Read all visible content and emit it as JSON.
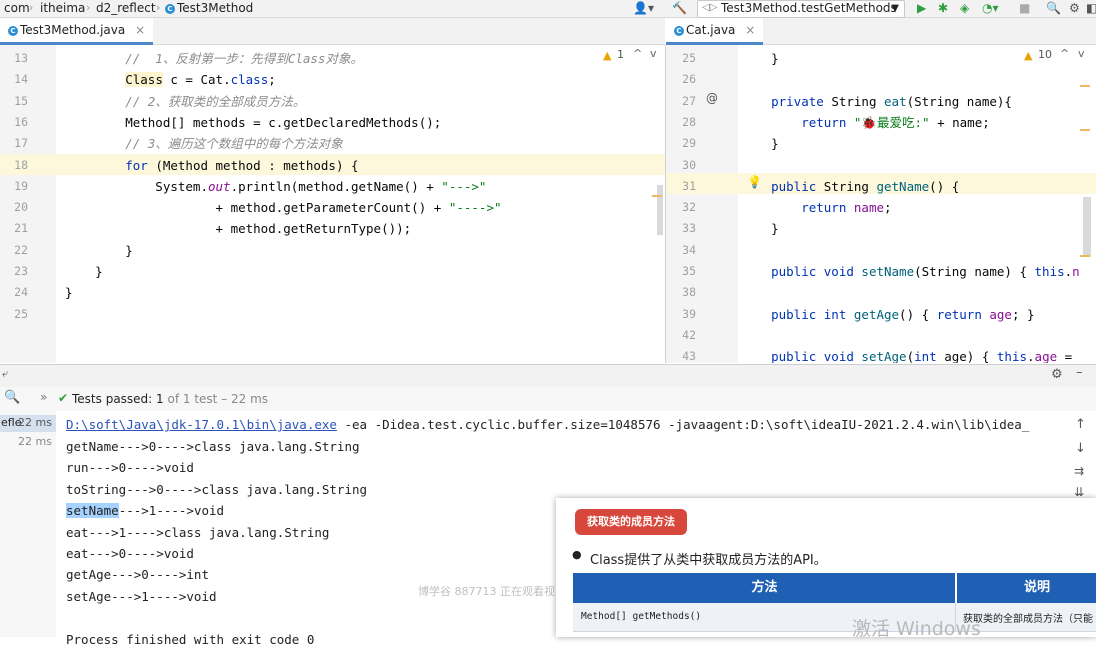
{
  "breadcrumb": [
    "com",
    "itheima",
    "d2_reflect",
    "Test3Method"
  ],
  "run_config": "Test3Method.testGetMethods",
  "left_editor": {
    "tab": "Test3Method.java",
    "warnings": "1",
    "lines": [
      {
        "n": "13",
        "code": [
          [
            "cm",
            "        //  1、反射第一步：先得到Class对象。"
          ]
        ]
      },
      {
        "n": "14",
        "code": [
          [
            "",
            "        "
          ],
          [
            "hl",
            "Class"
          ],
          [
            "",
            " c = Cat."
          ],
          [
            "kw",
            "class"
          ],
          [
            "",
            ";"
          ]
        ]
      },
      {
        "n": "15",
        "code": [
          [
            "cm",
            "        // 2、获取类的全部成员方法。"
          ]
        ]
      },
      {
        "n": "16",
        "code": [
          [
            "",
            "        Method[] methods = c.getDeclaredMethods();"
          ]
        ]
      },
      {
        "n": "17",
        "code": [
          [
            "cm",
            "        // 3、遍历这个数组中的每个方法对象"
          ]
        ]
      },
      {
        "n": "18",
        "code": [
          [
            "",
            "        "
          ],
          [
            "kw",
            "for"
          ],
          [
            "",
            " (Method method : methods) {"
          ]
        ]
      },
      {
        "n": "19",
        "code": [
          [
            "",
            "            System."
          ],
          [
            "fdi",
            "out"
          ],
          [
            "",
            ".println(method.getName() + "
          ],
          [
            "st",
            "\"--->\""
          ]
        ]
      },
      {
        "n": "20",
        "code": [
          [
            "",
            "                    + method.getParameterCount() + "
          ],
          [
            "st",
            "\"---->\""
          ]
        ]
      },
      {
        "n": "21",
        "code": [
          [
            "",
            "                    + method.getReturnType());"
          ]
        ]
      },
      {
        "n": "22",
        "code": [
          [
            "",
            "        }"
          ]
        ]
      },
      {
        "n": "23",
        "code": [
          [
            "",
            "    }"
          ]
        ]
      },
      {
        "n": "24",
        "code": [
          [
            "",
            "}"
          ]
        ]
      },
      {
        "n": "25",
        "code": [
          [
            "",
            ""
          ]
        ]
      }
    ]
  },
  "right_editor": {
    "tab": "Cat.java",
    "warnings": "10",
    "lines": [
      {
        "n": "25",
        "code": [
          [
            "",
            "    }"
          ]
        ]
      },
      {
        "n": "26",
        "code": [
          [
            "",
            ""
          ]
        ]
      },
      {
        "n": "27",
        "code": [
          [
            "kw",
            "    private"
          ],
          [
            "",
            " String "
          ],
          [
            "mt",
            "eat"
          ],
          [
            "",
            "(String name){"
          ]
        ]
      },
      {
        "n": "28",
        "code": [
          [
            "kw",
            "        return"
          ],
          [
            "",
            " "
          ],
          [
            "st",
            "\"🐞最爱吃:\""
          ],
          [
            "",
            " + name;"
          ]
        ]
      },
      {
        "n": "29",
        "code": [
          [
            "",
            "    }"
          ]
        ]
      },
      {
        "n": "30",
        "code": [
          [
            "",
            ""
          ]
        ]
      },
      {
        "n": "31",
        "code": [
          [
            "kw",
            "    public"
          ],
          [
            "",
            " String "
          ],
          [
            "mt",
            "getName"
          ],
          [
            "",
            "() {"
          ]
        ]
      },
      {
        "n": "32",
        "code": [
          [
            "kw",
            "        return"
          ],
          [
            "",
            " "
          ],
          [
            "fd",
            "name"
          ],
          [
            "",
            ";"
          ]
        ]
      },
      {
        "n": "33",
        "code": [
          [
            "",
            "    }"
          ]
        ]
      },
      {
        "n": "34",
        "code": [
          [
            "",
            ""
          ]
        ]
      },
      {
        "n": "35",
        "code": [
          [
            "kw",
            "    public void"
          ],
          [
            "",
            " "
          ],
          [
            "mt",
            "setName"
          ],
          [
            "",
            "(String name) { "
          ],
          [
            "kw",
            "this"
          ],
          [
            "",
            "."
          ],
          [
            "fd",
            "n"
          ]
        ]
      },
      {
        "n": "38",
        "code": [
          [
            "",
            ""
          ]
        ]
      },
      {
        "n": "39",
        "code": [
          [
            "kw",
            "    public int"
          ],
          [
            "",
            " "
          ],
          [
            "mt",
            "getAge"
          ],
          [
            "",
            "() { "
          ],
          [
            "kw",
            "return"
          ],
          [
            "",
            " "
          ],
          [
            "fd",
            "age"
          ],
          [
            "",
            "; }"
          ]
        ]
      },
      {
        "n": "42",
        "code": [
          [
            "",
            ""
          ]
        ]
      },
      {
        "n": "43",
        "code": [
          [
            "kw",
            "    public void"
          ],
          [
            "",
            " "
          ],
          [
            "mt",
            "setAge"
          ],
          [
            "",
            "("
          ],
          [
            "kw",
            "int"
          ],
          [
            "",
            " age) { "
          ],
          [
            "kw",
            "this"
          ],
          [
            "",
            "."
          ],
          [
            "fd",
            "age"
          ],
          [
            "",
            " = "
          ]
        ]
      }
    ]
  },
  "test_status": {
    "label": "Tests passed:",
    "count": "1",
    "rest": "of 1 test – 22 ms"
  },
  "test_tree": [
    {
      "name": "efle",
      "time": "22 ms"
    },
    {
      "name": "",
      "time": "22 ms"
    }
  ],
  "console": {
    "command_link": "D:\\soft\\Java\\jdk-17.0.1\\bin\\java.exe",
    "command_rest": " -ea -Didea.test.cyclic.buffer.size=1048576 -javaagent:D:\\soft\\ideaIU-2021.2.4.win\\lib\\idea_",
    "lines": [
      "getName--->0---->class java.lang.String",
      "run--->0---->void",
      "toString--->0---->class java.lang.String",
      "setName--->1---->void",
      "eat--->1---->class java.lang.String",
      "eat--->0---->void",
      "getAge--->0---->int",
      "setAge--->1---->void",
      "",
      "Process finished with exit code 0"
    ],
    "selected_word": "setName"
  },
  "watermark": "博学谷 887713 正在观看视",
  "slide": {
    "badge": "获取类的成员方法",
    "bullet": "Class提供了从类中获取成员方法的API。",
    "col_method": "方法",
    "col_desc": "说明",
    "row_method": "Method[] getMethods()",
    "row_desc": "获取类的全部成员方法（只能"
  },
  "activation": "激活 Windows"
}
